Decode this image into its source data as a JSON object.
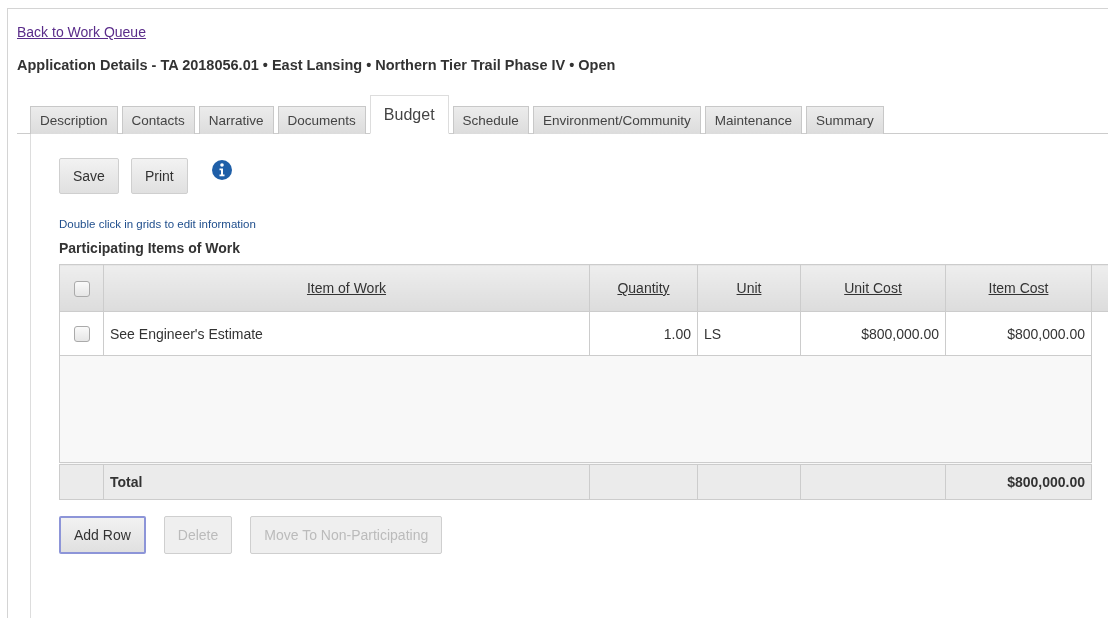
{
  "back_link": "Back to Work Queue",
  "heading": "Application Details - TA 2018056.01 • East Lansing • Northern Tier Trail Phase IV • Open",
  "tabs": [
    {
      "label": "Description",
      "selected": false
    },
    {
      "label": "Contacts",
      "selected": false
    },
    {
      "label": "Narrative",
      "selected": false
    },
    {
      "label": "Documents",
      "selected": false
    },
    {
      "label": "Budget",
      "selected": true
    },
    {
      "label": "Schedule",
      "selected": false
    },
    {
      "label": "Environment/Community",
      "selected": false
    },
    {
      "label": "Maintenance",
      "selected": false
    },
    {
      "label": "Summary",
      "selected": false
    }
  ],
  "toolbar": {
    "buttons": [
      {
        "label": "Save"
      },
      {
        "label": "Print"
      }
    ]
  },
  "hint": "Double click in grids to edit information",
  "section_title": "Participating Items of Work",
  "table": {
    "select_all": {
      "checked": false
    },
    "columns": [
      {
        "label": "Item of Work",
        "kind": "text"
      },
      {
        "label": "Quantity",
        "kind": "number"
      },
      {
        "label": "Unit",
        "kind": "text"
      },
      {
        "label": "Unit Cost",
        "kind": "number"
      },
      {
        "label": "Item Cost",
        "kind": "number"
      }
    ],
    "rows": [
      {
        "checked": false,
        "cells": [
          "See Engineer's Estimate",
          "1.00",
          "LS",
          "$800,000.00",
          "$800,000.00"
        ]
      }
    ],
    "total": {
      "label": "Total",
      "item_cost": "$800,000.00"
    }
  },
  "actions": [
    {
      "label": "Add Row",
      "disabled": false,
      "focused": true
    },
    {
      "label": "Delete",
      "disabled": true,
      "focused": false
    },
    {
      "label": "Move To Non-Participating",
      "disabled": true,
      "focused": false
    }
  ]
}
